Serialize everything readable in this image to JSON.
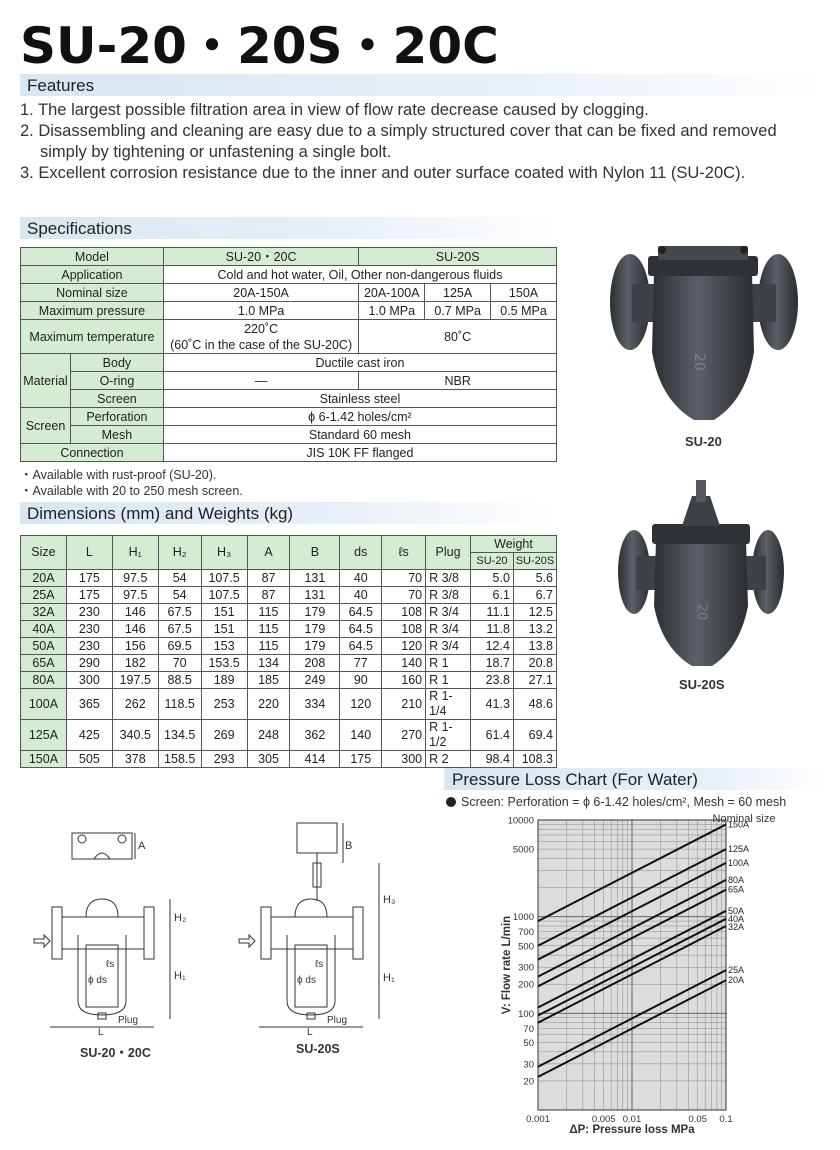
{
  "title": "SU-20・20S・20C",
  "features": {
    "heading": "Features",
    "items": [
      "1. The largest possible filtration area in view of flow rate decrease caused by clogging.",
      "2. Disassembling and cleaning are easy due to a simply structured cover that can be fixed and removed simply by tightening or unfastening a single bolt.",
      "3. Excellent corrosion resistance due to the inner and outer surface coated with Nylon 11 (SU-20C)."
    ]
  },
  "specifications": {
    "heading": "Specifications",
    "model_label": "Model",
    "model_a": "SU-20・20C",
    "model_b": "SU-20S",
    "application_label": "Application",
    "application": "Cold and hot water, Oil, Other non-dangerous fluids",
    "nominal_label": "Nominal size",
    "nominal_a": "20A-150A",
    "nominal_b1": "20A-100A",
    "nominal_b2": "125A",
    "nominal_b3": "150A",
    "pressure_label": "Maximum pressure",
    "pressure_a": "1.0 MPa",
    "pressure_b1": "1.0 MPa",
    "pressure_b2": "0.7 MPa",
    "pressure_b3": "0.5 MPa",
    "temp_label": "Maximum temperature",
    "temp_a1": "220˚C",
    "temp_a2": "(60˚C in the case of the SU-20C)",
    "temp_b": "80˚C",
    "material_label": "Material",
    "body_label": "Body",
    "body": "Ductile cast iron",
    "oring_label": "O-ring",
    "oring_a": "—",
    "oring_b": "NBR",
    "screen_mat_label": "Screen",
    "screen_mat": "Stainless steel",
    "screen_label": "Screen",
    "perforation_label": "Perforation",
    "perforation": "ϕ 6-1.42 holes/cm²",
    "mesh_label": "Mesh",
    "mesh": "Standard 60 mesh",
    "connection_label": "Connection",
    "connection": "JIS 10K FF flanged"
  },
  "notes": [
    "・Available with rust-proof (SU-20).",
    "・Available with 20 to 250 mesh screen."
  ],
  "dimensions": {
    "heading": "Dimensions (mm) and Weights (kg)",
    "headers": [
      "Size",
      "L",
      "H₁",
      "H₂",
      "H₃",
      "A",
      "B",
      "ds",
      "ℓs",
      "Plug"
    ],
    "weight_label": "Weight",
    "weight_sub": [
      "SU-20",
      "SU-20S"
    ],
    "rows": [
      [
        "20A",
        "175",
        "97.5",
        "54",
        "107.5",
        "87",
        "131",
        "40",
        "70",
        "R 3/8",
        "5.0",
        "5.6"
      ],
      [
        "25A",
        "175",
        "97.5",
        "54",
        "107.5",
        "87",
        "131",
        "40",
        "70",
        "R 3/8",
        "6.1",
        "6.7"
      ],
      [
        "32A",
        "230",
        "146",
        "67.5",
        "151",
        "115",
        "179",
        "64.5",
        "108",
        "R 3/4",
        "11.1",
        "12.5"
      ],
      [
        "40A",
        "230",
        "146",
        "67.5",
        "151",
        "115",
        "179",
        "64.5",
        "108",
        "R 3/4",
        "11.8",
        "13.2"
      ],
      [
        "50A",
        "230",
        "156",
        "69.5",
        "153",
        "115",
        "179",
        "64.5",
        "120",
        "R 3/4",
        "12.4",
        "13.8"
      ],
      [
        "65A",
        "290",
        "182",
        "70",
        "153.5",
        "134",
        "208",
        "77",
        "140",
        "R 1",
        "18.7",
        "20.8"
      ],
      [
        "80A",
        "300",
        "197.5",
        "88.5",
        "189",
        "185",
        "249",
        "90",
        "160",
        "R 1",
        "23.8",
        "27.1"
      ],
      [
        "100A",
        "365",
        "262",
        "118.5",
        "253",
        "220",
        "334",
        "120",
        "210",
        "R 1-1/4",
        "41.3",
        "48.6"
      ],
      [
        "125A",
        "425",
        "340.5",
        "134.5",
        "269",
        "248",
        "362",
        "140",
        "270",
        "R 1-1/2",
        "61.4",
        "69.4"
      ],
      [
        "150A",
        "505",
        "378",
        "158.5",
        "293",
        "305",
        "414",
        "175",
        "300",
        "R 2",
        "98.4",
        "108.3"
      ]
    ]
  },
  "photos": {
    "su20_caption": "SU-20",
    "su20s_caption": "SU-20S",
    "su20_body_text": "20",
    "su20s_body_text": "20"
  },
  "drawings": {
    "left_caption": "SU-20・20C",
    "right_caption": "SU-20S",
    "labels": [
      "A",
      "B",
      "H₂",
      "H₁",
      "H₃",
      "ℓs",
      "ϕ ds",
      "Plug",
      "L"
    ]
  },
  "chart": {
    "heading": "Pressure Loss Chart (For Water)",
    "screen_note": "Screen: Perforation = ϕ 6-1.42 holes/cm², Mesh = 60 mesh",
    "nominal_size_label": "Nominal size"
  },
  "chart_data": {
    "type": "line",
    "title": "Pressure Loss Chart (For Water)",
    "xlabel": "ΔP: Pressure loss MPa",
    "ylabel": "V: Flow rate L/min",
    "xscale": "log",
    "yscale": "log",
    "xlim": [
      0.001,
      0.1
    ],
    "ylim": [
      10,
      10000
    ],
    "x_ticks": [
      "0.001",
      "0.005",
      "0.01",
      "0.05",
      "0.1"
    ],
    "y_ticks": [
      "10000",
      "5000",
      "1000",
      "700",
      "500",
      "300",
      "200",
      "100",
      "70",
      "50",
      "30",
      "20"
    ],
    "grid": true,
    "legend_title": "Nominal size",
    "series": [
      {
        "name": "150A",
        "points": [
          [
            0.001,
            900
          ],
          [
            0.1,
            9000
          ]
        ]
      },
      {
        "name": "125A",
        "points": [
          [
            0.001,
            500
          ],
          [
            0.1,
            5000
          ]
        ]
      },
      {
        "name": "100A",
        "points": [
          [
            0.001,
            360
          ],
          [
            0.1,
            3600
          ]
        ]
      },
      {
        "name": "80A",
        "points": [
          [
            0.001,
            240
          ],
          [
            0.1,
            2400
          ]
        ]
      },
      {
        "name": "65A",
        "points": [
          [
            0.001,
            190
          ],
          [
            0.1,
            1900
          ]
        ]
      },
      {
        "name": "50A",
        "points": [
          [
            0.001,
            115
          ],
          [
            0.1,
            1150
          ]
        ]
      },
      {
        "name": "40A",
        "points": [
          [
            0.001,
            95
          ],
          [
            0.1,
            950
          ]
        ]
      },
      {
        "name": "32A",
        "points": [
          [
            0.001,
            80
          ],
          [
            0.1,
            800
          ]
        ]
      },
      {
        "name": "25A",
        "points": [
          [
            0.001,
            28
          ],
          [
            0.1,
            280
          ]
        ]
      },
      {
        "name": "20A",
        "points": [
          [
            0.001,
            22
          ],
          [
            0.1,
            220
          ]
        ]
      }
    ]
  }
}
